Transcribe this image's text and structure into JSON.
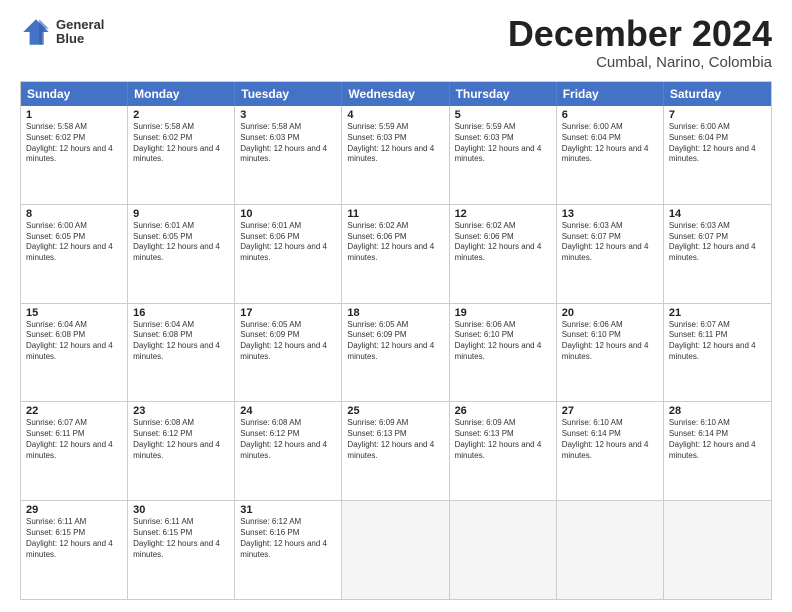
{
  "header": {
    "logo_line1": "General",
    "logo_line2": "Blue",
    "month": "December 2024",
    "location": "Cumbal, Narino, Colombia"
  },
  "weekdays": [
    "Sunday",
    "Monday",
    "Tuesday",
    "Wednesday",
    "Thursday",
    "Friday",
    "Saturday"
  ],
  "rows": [
    [
      {
        "day": "1",
        "rise": "5:58 AM",
        "set": "6:02 PM",
        "daylight": "12 hours and 4 minutes."
      },
      {
        "day": "2",
        "rise": "5:58 AM",
        "set": "6:02 PM",
        "daylight": "12 hours and 4 minutes."
      },
      {
        "day": "3",
        "rise": "5:58 AM",
        "set": "6:03 PM",
        "daylight": "12 hours and 4 minutes."
      },
      {
        "day": "4",
        "rise": "5:59 AM",
        "set": "6:03 PM",
        "daylight": "12 hours and 4 minutes."
      },
      {
        "day": "5",
        "rise": "5:59 AM",
        "set": "6:03 PM",
        "daylight": "12 hours and 4 minutes."
      },
      {
        "day": "6",
        "rise": "6:00 AM",
        "set": "6:04 PM",
        "daylight": "12 hours and 4 minutes."
      },
      {
        "day": "7",
        "rise": "6:00 AM",
        "set": "6:04 PM",
        "daylight": "12 hours and 4 minutes."
      }
    ],
    [
      {
        "day": "8",
        "rise": "6:00 AM",
        "set": "6:05 PM",
        "daylight": "12 hours and 4 minutes."
      },
      {
        "day": "9",
        "rise": "6:01 AM",
        "set": "6:05 PM",
        "daylight": "12 hours and 4 minutes."
      },
      {
        "day": "10",
        "rise": "6:01 AM",
        "set": "6:06 PM",
        "daylight": "12 hours and 4 minutes."
      },
      {
        "day": "11",
        "rise": "6:02 AM",
        "set": "6:06 PM",
        "daylight": "12 hours and 4 minutes."
      },
      {
        "day": "12",
        "rise": "6:02 AM",
        "set": "6:06 PM",
        "daylight": "12 hours and 4 minutes."
      },
      {
        "day": "13",
        "rise": "6:03 AM",
        "set": "6:07 PM",
        "daylight": "12 hours and 4 minutes."
      },
      {
        "day": "14",
        "rise": "6:03 AM",
        "set": "6:07 PM",
        "daylight": "12 hours and 4 minutes."
      }
    ],
    [
      {
        "day": "15",
        "rise": "6:04 AM",
        "set": "6:08 PM",
        "daylight": "12 hours and 4 minutes."
      },
      {
        "day": "16",
        "rise": "6:04 AM",
        "set": "6:08 PM",
        "daylight": "12 hours and 4 minutes."
      },
      {
        "day": "17",
        "rise": "6:05 AM",
        "set": "6:09 PM",
        "daylight": "12 hours and 4 minutes."
      },
      {
        "day": "18",
        "rise": "6:05 AM",
        "set": "6:09 PM",
        "daylight": "12 hours and 4 minutes."
      },
      {
        "day": "19",
        "rise": "6:06 AM",
        "set": "6:10 PM",
        "daylight": "12 hours and 4 minutes."
      },
      {
        "day": "20",
        "rise": "6:06 AM",
        "set": "6:10 PM",
        "daylight": "12 hours and 4 minutes."
      },
      {
        "day": "21",
        "rise": "6:07 AM",
        "set": "6:11 PM",
        "daylight": "12 hours and 4 minutes."
      }
    ],
    [
      {
        "day": "22",
        "rise": "6:07 AM",
        "set": "6:11 PM",
        "daylight": "12 hours and 4 minutes."
      },
      {
        "day": "23",
        "rise": "6:08 AM",
        "set": "6:12 PM",
        "daylight": "12 hours and 4 minutes."
      },
      {
        "day": "24",
        "rise": "6:08 AM",
        "set": "6:12 PM",
        "daylight": "12 hours and 4 minutes."
      },
      {
        "day": "25",
        "rise": "6:09 AM",
        "set": "6:13 PM",
        "daylight": "12 hours and 4 minutes."
      },
      {
        "day": "26",
        "rise": "6:09 AM",
        "set": "6:13 PM",
        "daylight": "12 hours and 4 minutes."
      },
      {
        "day": "27",
        "rise": "6:10 AM",
        "set": "6:14 PM",
        "daylight": "12 hours and 4 minutes."
      },
      {
        "day": "28",
        "rise": "6:10 AM",
        "set": "6:14 PM",
        "daylight": "12 hours and 4 minutes."
      }
    ],
    [
      {
        "day": "29",
        "rise": "6:11 AM",
        "set": "6:15 PM",
        "daylight": "12 hours and 4 minutes."
      },
      {
        "day": "30",
        "rise": "6:11 AM",
        "set": "6:15 PM",
        "daylight": "12 hours and 4 minutes."
      },
      {
        "day": "31",
        "rise": "6:12 AM",
        "set": "6:16 PM",
        "daylight": "12 hours and 4 minutes."
      },
      null,
      null,
      null,
      null
    ]
  ]
}
